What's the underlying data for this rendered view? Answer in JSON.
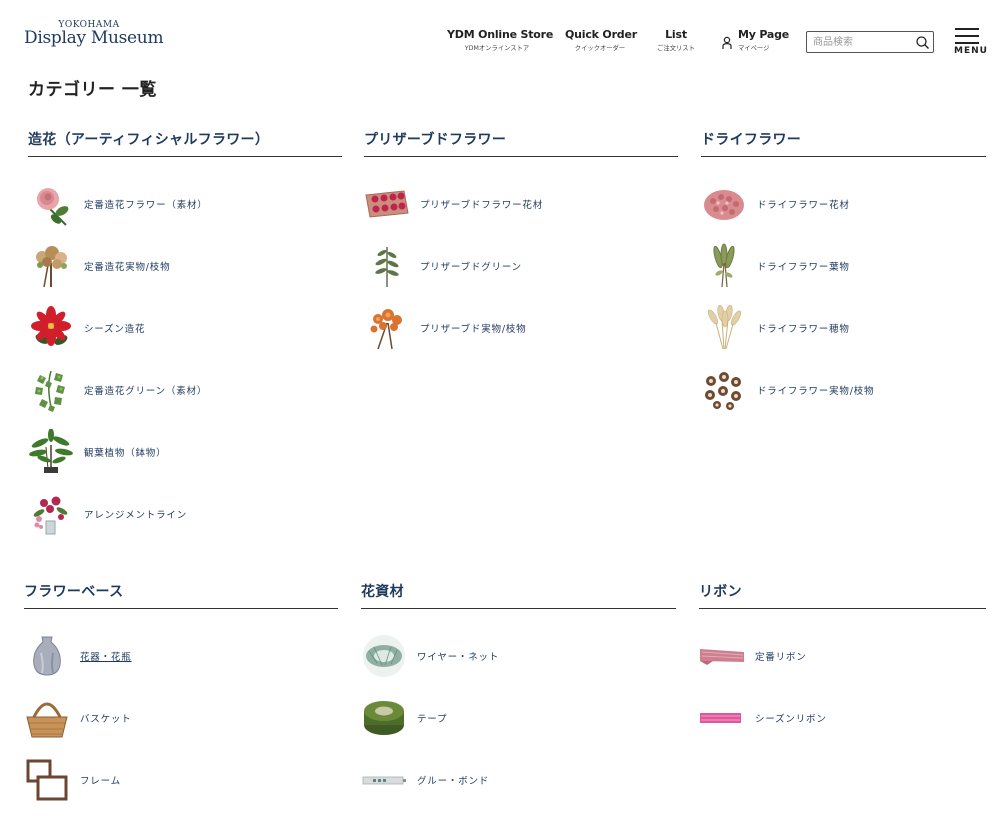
{
  "header": {
    "logo_sub": "YOKOHAMA",
    "logo_main": "Display Museum",
    "nav": [
      {
        "label": "YDM Online Store",
        "sub": "YDMオンラインストア"
      },
      {
        "label": "Quick Order",
        "sub": "クイックオーダー"
      },
      {
        "label": "List",
        "sub": "ご注文リスト"
      },
      {
        "label": "My Page",
        "sub": "マイページ",
        "icon": "person-icon"
      }
    ],
    "search_placeholder": "商品検索",
    "search_icon": "search-icon",
    "menu_label": "MENU"
  },
  "page_title": "カテゴリー 一覧",
  "colors": {
    "heading": "#1f3a5f",
    "text": "#222222",
    "rule": "#333333"
  },
  "sections": [
    {
      "title": "造花（アーティフィシャルフラワー）",
      "items": [
        {
          "label": "定番造花フラワー（素材）",
          "icon": "pink-rose-icon"
        },
        {
          "label": "定番造花実物/枝物",
          "icon": "berry-branch-icon"
        },
        {
          "label": "シーズン造花",
          "icon": "poinsettia-icon"
        },
        {
          "label": "定番造花グリーン（素材）",
          "icon": "ivy-icon"
        },
        {
          "label": "観葉植物（鉢物）",
          "icon": "potted-plant-icon"
        },
        {
          "label": "アレンジメントライン",
          "icon": "arrangement-icon"
        }
      ]
    },
    {
      "title": "プリザーブドフラワー",
      "items": [
        {
          "label": "プリザーブドフラワー花材",
          "icon": "preserved-box-icon"
        },
        {
          "label": "プリザーブドグリーン",
          "icon": "green-sprig-icon"
        },
        {
          "label": "プリザーブド実物/枝物",
          "icon": "orange-branch-icon"
        }
      ]
    },
    {
      "title": "ドライフラワー",
      "items": [
        {
          "label": "ドライフラワー花材",
          "icon": "dried-pink-icon"
        },
        {
          "label": "ドライフラワー葉物",
          "icon": "dried-leaf-icon"
        },
        {
          "label": "ドライフラワー穂物",
          "icon": "dried-grass-icon"
        },
        {
          "label": "ドライフラワー実物/枝物",
          "icon": "pinecone-icon"
        }
      ]
    },
    {
      "title": "フラワーベース",
      "items": [
        {
          "label": "花器・花瓶",
          "icon": "vase-icon",
          "link": true
        },
        {
          "label": "バスケット",
          "icon": "basket-icon"
        },
        {
          "label": "フレーム",
          "icon": "frame-icon"
        }
      ]
    },
    {
      "title": "花資材",
      "items": [
        {
          "label": "ワイヤー・ネット",
          "icon": "wire-net-icon"
        },
        {
          "label": "テープ",
          "icon": "tape-icon"
        },
        {
          "label": "グルー・ボンド",
          "icon": "glue-icon"
        }
      ]
    },
    {
      "title": "リボン",
      "items": [
        {
          "label": "定番リボン",
          "icon": "ribbon-icon"
        },
        {
          "label": "シーズンリボン",
          "icon": "season-ribbon-icon"
        }
      ]
    }
  ]
}
